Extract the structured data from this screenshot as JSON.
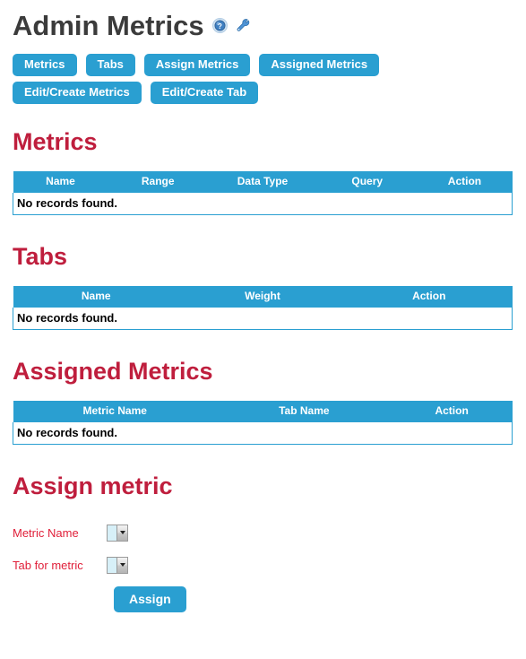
{
  "header": {
    "title": "Admin Metrics",
    "icons": [
      {
        "name": "help-icon",
        "label": "Help"
      },
      {
        "name": "wrench-icon",
        "label": "Settings"
      }
    ]
  },
  "nav": {
    "buttons": [
      {
        "label": "Metrics"
      },
      {
        "label": "Tabs"
      },
      {
        "label": "Assign Metrics"
      },
      {
        "label": "Assigned Metrics"
      },
      {
        "label": "Edit/Create Metrics"
      },
      {
        "label": "Edit/Create Tab"
      }
    ]
  },
  "sections": {
    "metrics": {
      "heading": "Metrics",
      "columns": [
        "Name",
        "Range",
        "Data Type",
        "Query",
        "Action"
      ],
      "rows": [],
      "empty_text": "No records found."
    },
    "tabs": {
      "heading": "Tabs",
      "columns": [
        "Name",
        "Weight",
        "Action"
      ],
      "rows": [],
      "empty_text": "No records found."
    },
    "assigned_metrics": {
      "heading": "Assigned Metrics",
      "columns": [
        "Metric Name",
        "Tab Name",
        "Action"
      ],
      "rows": [],
      "empty_text": "No records found."
    },
    "assign_form": {
      "heading": "Assign metric",
      "fields": [
        {
          "label": "Metric Name",
          "value": "",
          "options": []
        },
        {
          "label": "Tab for metric",
          "value": "",
          "options": []
        }
      ],
      "submit_label": "Assign"
    }
  },
  "colors": {
    "accent_blue": "#2a9fd1",
    "heading_red": "#bf1e3d",
    "label_red": "#e0203a",
    "title_grey": "#3b3b3b"
  }
}
